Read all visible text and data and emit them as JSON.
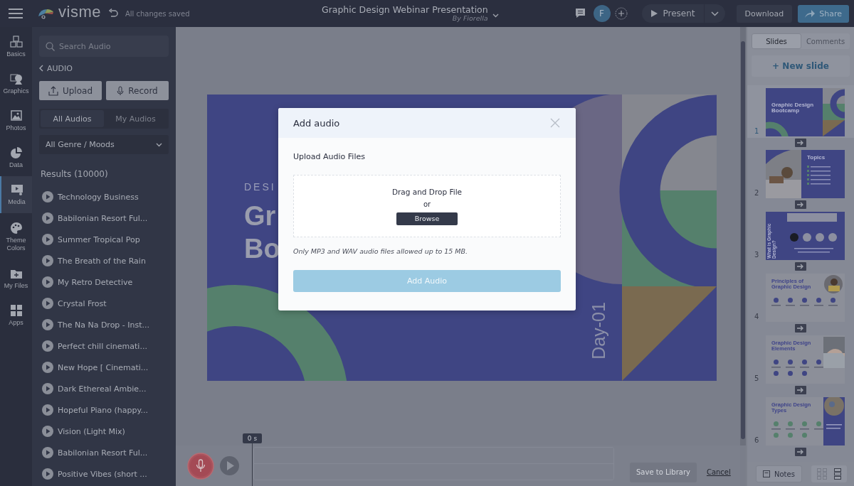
{
  "header": {
    "app_name": "visme",
    "save_status": "All changes saved",
    "title": "Graphic Design Webinar Presentation",
    "author": "By Fiorella",
    "avatar": "F",
    "present": "Present",
    "download": "Download",
    "share": "Share"
  },
  "rail": [
    {
      "label": "Basics",
      "selected": false
    },
    {
      "label": "Graphics",
      "selected": false
    },
    {
      "label": "Photos",
      "selected": false
    },
    {
      "label": "Data",
      "selected": false
    },
    {
      "label": "Media",
      "selected": true
    },
    {
      "label": "Theme Colors",
      "selected": false
    },
    {
      "label": "My Files",
      "selected": false
    },
    {
      "label": "Apps",
      "selected": false
    }
  ],
  "audio_panel": {
    "search_placeholder": "Search Audio",
    "back": "AUDIO",
    "upload": "Upload",
    "record": "Record",
    "tabs": [
      {
        "label": "All Audios",
        "selected": true
      },
      {
        "label": "My Audios",
        "selected": false
      }
    ],
    "genre": "All Genre / Moods",
    "results": "Results (10000)",
    "tracks": [
      "Technology Business",
      "Babilonian Resort Ful...",
      "Summer Tropical Pop",
      "The Breath of the Rain",
      "My Retro Detective",
      "Crystal Frost",
      "The Na Na Drop - Inst...",
      "Perfect chill cinemati...",
      "New Hope [ Cinemati...",
      "Dark Ethereal Ambie...",
      "Hopeful Piano (happy...",
      "Vision (Light Mix)",
      "Babilonian Resort Ful...",
      "Positive Vibes (short ..."
    ]
  },
  "slide": {
    "eyebrow": "DESI",
    "title_lines": [
      "Gr",
      "Bo"
    ],
    "day": "Day-01"
  },
  "dialog": {
    "title": "Add audio",
    "section": "Upload Audio Files",
    "drop": "Drag and Drop File",
    "or": "or",
    "browse": "Browse",
    "note": "Only MP3 and WAV audio files allowed up to 15 MB.",
    "add": "Add Audio"
  },
  "recorder": {
    "time": "0 s",
    "save": "Save to Library",
    "cancel": "Cancel"
  },
  "slides_panel": {
    "tabs": [
      {
        "label": "Slides",
        "selected": true
      },
      {
        "label": "Comments",
        "selected": false
      }
    ],
    "new_slide": "+ New slide",
    "slides": [
      {
        "number": "1",
        "kind": "cover",
        "title": "Graphic Design Bootcamp",
        "selected": true
      },
      {
        "number": "2",
        "kind": "topics",
        "title": "Topics",
        "selected": false
      },
      {
        "number": "3",
        "kind": "quote",
        "title": "What is Graphic Design?",
        "selected": false
      },
      {
        "number": "4",
        "kind": "principles",
        "title": "Principles of Graphic Design",
        "selected": false
      },
      {
        "number": "5",
        "kind": "elements",
        "title": "Graphic Design Elements",
        "selected": false
      },
      {
        "number": "6",
        "kind": "types",
        "title": "Graphic Design Types",
        "selected": false
      }
    ],
    "notes": "Notes"
  }
}
